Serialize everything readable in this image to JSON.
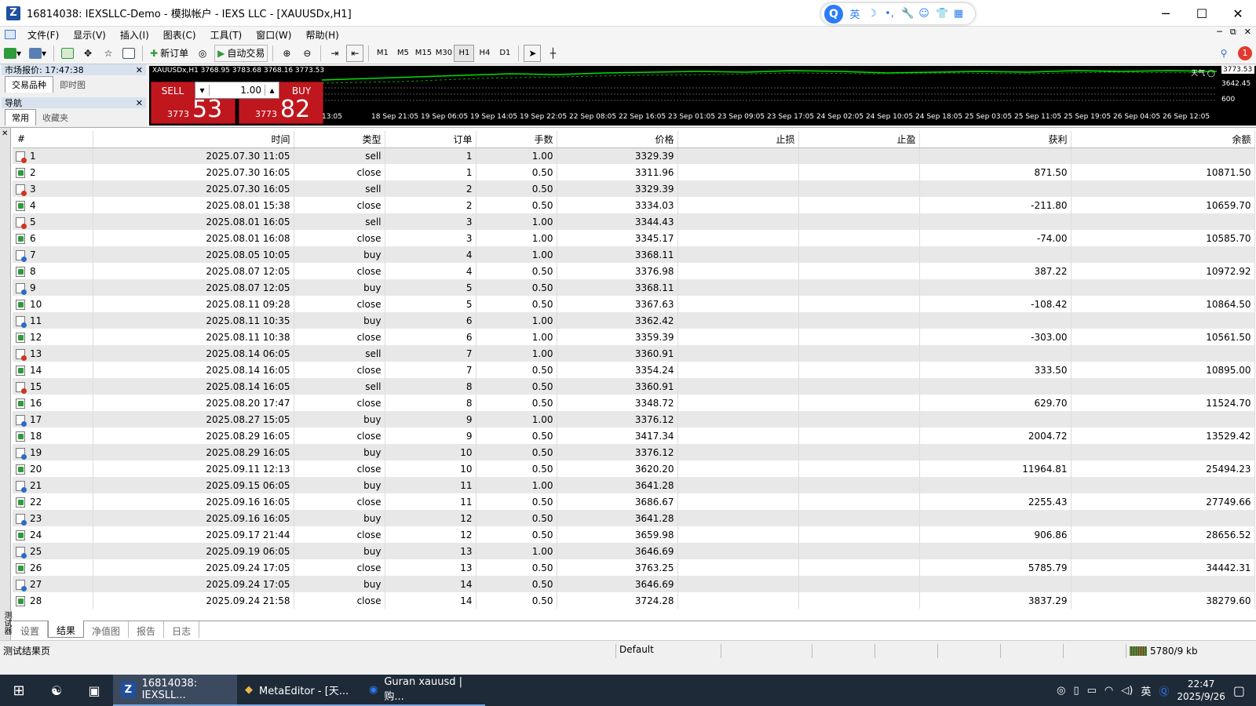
{
  "window": {
    "title": "16814038: IEXSLLC-Demo - 模拟帐户 - IEXS LLC - [XAUUSDx,H1]",
    "app_icon": "Z",
    "controls": {
      "minimize": "─",
      "maximize": "☐",
      "close": "✕"
    }
  },
  "ime": {
    "logo": "Q",
    "lang": "英",
    "items": [
      "☽",
      "•,",
      "🔧",
      "☺",
      "👕",
      "▦"
    ]
  },
  "menu": {
    "items": [
      "文件(F)",
      "显示(V)",
      "插入(I)",
      "图表(C)",
      "工具(T)",
      "窗口(W)",
      "帮助(H)"
    ],
    "mdi": [
      "─",
      "⧉",
      "✕"
    ]
  },
  "toolbar": {
    "new_order": "新订单",
    "auto_trade": "自动交易",
    "timeframes": [
      "M1",
      "M5",
      "M15",
      "M30",
      "H1",
      "H4",
      "D1"
    ],
    "active_timeframe": "H1",
    "notification_count": "1"
  },
  "market_watch": {
    "title": "市场报价: 17:47:38",
    "tabs": [
      "交易品种",
      "即时图"
    ],
    "active_tab": "交易品种"
  },
  "navigator": {
    "title": "导航",
    "tabs": [
      "常用",
      "收藏夹"
    ],
    "active_tab": "常用"
  },
  "chart": {
    "header": "XAUUSDx,H1  3768.95 3783.68 3768.16 3773.53",
    "sell_label": "SELL",
    "buy_label": "BUY",
    "lot": "1.00",
    "sell_price_small": "3773",
    "sell_price_big": "53",
    "buy_price_small": "3773",
    "buy_price_big": "82",
    "price_labels": [
      "3773.53",
      "3642.45",
      "600"
    ],
    "time_labels": [
      "13:05",
      "18 Sep 21:05",
      "19 Sep 06:05",
      "19 Sep 14:05",
      "19 Sep 22:05",
      "22 Sep 08:05",
      "22 Sep 16:05",
      "23 Sep 01:05",
      "23 Sep 09:05",
      "23 Sep 17:05",
      "24 Sep 02:05",
      "24 Sep 10:05",
      "24 Sep 18:05",
      "25 Sep 03:05",
      "25 Sep 11:05",
      "25 Sep 19:05",
      "26 Sep 04:05",
      "26 Sep 12:05"
    ],
    "corner_label": "天气 ◯",
    "line_color": "#00e000"
  },
  "results": {
    "columns": [
      "#",
      "时间",
      "类型",
      "订单",
      "手数",
      "价格",
      "止损",
      "止盈",
      "获利",
      "余额"
    ],
    "rows": [
      [
        "1",
        "2025.07.30 11:05",
        "sell",
        "1",
        "1.00",
        "3329.39",
        "",
        "",
        "",
        ""
      ],
      [
        "2",
        "2025.07.30 16:05",
        "close",
        "1",
        "0.50",
        "3311.96",
        "",
        "",
        "871.50",
        "10871.50"
      ],
      [
        "3",
        "2025.07.30 16:05",
        "sell",
        "2",
        "0.50",
        "3329.39",
        "",
        "",
        "",
        ""
      ],
      [
        "4",
        "2025.08.01 15:38",
        "close",
        "2",
        "0.50",
        "3334.03",
        "",
        "",
        "-211.80",
        "10659.70"
      ],
      [
        "5",
        "2025.08.01 16:05",
        "sell",
        "3",
        "1.00",
        "3344.43",
        "",
        "",
        "",
        ""
      ],
      [
        "6",
        "2025.08.01 16:08",
        "close",
        "3",
        "1.00",
        "3345.17",
        "",
        "",
        "-74.00",
        "10585.70"
      ],
      [
        "7",
        "2025.08.05 10:05",
        "buy",
        "4",
        "1.00",
        "3368.11",
        "",
        "",
        "",
        ""
      ],
      [
        "8",
        "2025.08.07 12:05",
        "close",
        "4",
        "0.50",
        "3376.98",
        "",
        "",
        "387.22",
        "10972.92"
      ],
      [
        "9",
        "2025.08.07 12:05",
        "buy",
        "5",
        "0.50",
        "3368.11",
        "",
        "",
        "",
        ""
      ],
      [
        "10",
        "2025.08.11 09:28",
        "close",
        "5",
        "0.50",
        "3367.63",
        "",
        "",
        "-108.42",
        "10864.50"
      ],
      [
        "11",
        "2025.08.11 10:35",
        "buy",
        "6",
        "1.00",
        "3362.42",
        "",
        "",
        "",
        ""
      ],
      [
        "12",
        "2025.08.11 10:38",
        "close",
        "6",
        "1.00",
        "3359.39",
        "",
        "",
        "-303.00",
        "10561.50"
      ],
      [
        "13",
        "2025.08.14 06:05",
        "sell",
        "7",
        "1.00",
        "3360.91",
        "",
        "",
        "",
        ""
      ],
      [
        "14",
        "2025.08.14 16:05",
        "close",
        "7",
        "0.50",
        "3354.24",
        "",
        "",
        "333.50",
        "10895.00"
      ],
      [
        "15",
        "2025.08.14 16:05",
        "sell",
        "8",
        "0.50",
        "3360.91",
        "",
        "",
        "",
        ""
      ],
      [
        "16",
        "2025.08.20 17:47",
        "close",
        "8",
        "0.50",
        "3348.72",
        "",
        "",
        "629.70",
        "11524.70"
      ],
      [
        "17",
        "2025.08.27 15:05",
        "buy",
        "9",
        "1.00",
        "3376.12",
        "",
        "",
        "",
        ""
      ],
      [
        "18",
        "2025.08.29 16:05",
        "close",
        "9",
        "0.50",
        "3417.34",
        "",
        "",
        "2004.72",
        "13529.42"
      ],
      [
        "19",
        "2025.08.29 16:05",
        "buy",
        "10",
        "0.50",
        "3376.12",
        "",
        "",
        "",
        ""
      ],
      [
        "20",
        "2025.09.11 12:13",
        "close",
        "10",
        "0.50",
        "3620.20",
        "",
        "",
        "11964.81",
        "25494.23"
      ],
      [
        "21",
        "2025.09.15 06:05",
        "buy",
        "11",
        "1.00",
        "3641.28",
        "",
        "",
        "",
        ""
      ],
      [
        "22",
        "2025.09.16 16:05",
        "close",
        "11",
        "0.50",
        "3686.67",
        "",
        "",
        "2255.43",
        "27749.66"
      ],
      [
        "23",
        "2025.09.16 16:05",
        "buy",
        "12",
        "0.50",
        "3641.28",
        "",
        "",
        "",
        ""
      ],
      [
        "24",
        "2025.09.17 21:44",
        "close",
        "12",
        "0.50",
        "3659.98",
        "",
        "",
        "906.86",
        "28656.52"
      ],
      [
        "25",
        "2025.09.19 06:05",
        "buy",
        "13",
        "1.00",
        "3646.69",
        "",
        "",
        "",
        ""
      ],
      [
        "26",
        "2025.09.24 17:05",
        "close",
        "13",
        "0.50",
        "3763.25",
        "",
        "",
        "5785.79",
        "34442.31"
      ],
      [
        "27",
        "2025.09.24 17:05",
        "buy",
        "14",
        "0.50",
        "3646.69",
        "",
        "",
        "",
        ""
      ],
      [
        "28",
        "2025.09.24 21:58",
        "close",
        "14",
        "0.50",
        "3724.28",
        "",
        "",
        "3837.29",
        "38279.60"
      ]
    ]
  },
  "terminal": {
    "side_label": "测试器",
    "tabs": [
      "设置",
      "结果",
      "净值图",
      "报告",
      "日志"
    ],
    "active_tab": "结果"
  },
  "statusbar": {
    "left": "测试结果页",
    "profile": "Default",
    "traffic": "5780/9 kb"
  },
  "taskbar": {
    "windows": [
      "16814038: IEXSLL...",
      "MetaEditor - [天...",
      "Guran xauusd | 购..."
    ],
    "active_window": "16814038: IEXSLL...",
    "tray_lang": "英",
    "time": "22:47",
    "date": "2025/9/26"
  },
  "colors": {
    "sell_buy_bg": "#c0161e",
    "chart_bg": "#000000",
    "taskbar_bg": "#1f2a38"
  }
}
